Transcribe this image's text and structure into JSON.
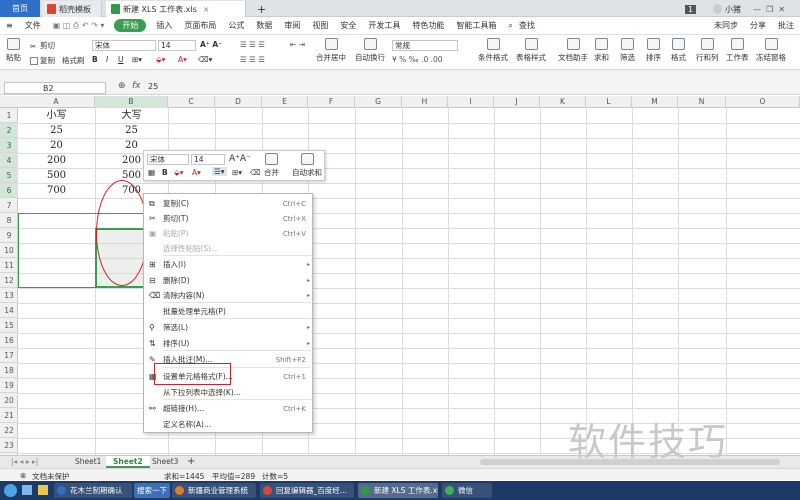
{
  "tabs": {
    "home": "首页",
    "docer": "稻壳模板",
    "doc": "新建 XLS 工作表.xls",
    "add": "+",
    "page_num": "1",
    "user": "小猪"
  },
  "menubar": {
    "file": "文件",
    "items": [
      "开始",
      "插入",
      "页面布局",
      "公式",
      "数据",
      "审阅",
      "视图",
      "安全",
      "开发工具",
      "特色功能",
      "智能工具箱"
    ],
    "search": "查找",
    "unsynced": "未同步",
    "share": "分享",
    "comment": "批注"
  },
  "ribbon": {
    "paste": "粘贴",
    "cut": "剪切",
    "copy": "复制",
    "format_painter": "格式刷",
    "font_name": "宋体",
    "font_size": "14",
    "merge": "合并居中",
    "wrap": "自动换行",
    "number_format": "常规",
    "cond_format": "条件格式",
    "table_style": "表格样式",
    "doc_helper": "文档助手",
    "sum": "求和",
    "filter": "筛选",
    "sort": "排序",
    "format": "格式",
    "rows_cols": "行和列",
    "worksheet": "工作表",
    "freeze": "冻结窗格"
  },
  "formula": {
    "cell_ref": "B2",
    "fx": "fx",
    "value": "25"
  },
  "grid": {
    "columns": [
      "A",
      "B",
      "C",
      "D",
      "E",
      "F",
      "G",
      "H",
      "I",
      "J",
      "K",
      "L",
      "M",
      "N",
      "O"
    ],
    "rows": [
      "1",
      "2",
      "3",
      "4",
      "5",
      "6",
      "7",
      "8",
      "9",
      "10",
      "11",
      "12",
      "13",
      "14",
      "15",
      "16",
      "17",
      "18",
      "19",
      "20",
      "21",
      "22",
      "23"
    ],
    "cells": {
      "A1": "小写",
      "B1": "大写",
      "A2": "25",
      "B2": "25",
      "A3": "20",
      "B3": "20",
      "A4": "200",
      "B4": "200",
      "A5": "500",
      "B5": "500",
      "A6": "700",
      "B6": "700"
    }
  },
  "mini_toolbar": {
    "font": "宋体",
    "size": "14",
    "merge": "合并",
    "autosum": "自动求和"
  },
  "context_menu": [
    {
      "label": "复制(C)",
      "shortcut": "Ctrl+C",
      "disabled": false
    },
    {
      "label": "剪切(T)",
      "shortcut": "Ctrl+X",
      "disabled": false
    },
    {
      "label": "粘贴(P)",
      "shortcut": "Ctrl+V",
      "disabled": true
    },
    {
      "label": "选择性粘贴(S)...",
      "shortcut": "",
      "disabled": true
    },
    {
      "label": "插入(I)",
      "shortcut": "",
      "disabled": false
    },
    {
      "label": "删除(D)",
      "shortcut": "",
      "disabled": false
    },
    {
      "label": "清除内容(N)",
      "shortcut": "",
      "disabled": false
    },
    {
      "label": "批量处理单元格(P)",
      "shortcut": "",
      "disabled": false
    },
    {
      "label": "筛选(L)",
      "shortcut": "",
      "disabled": false
    },
    {
      "label": "排序(U)",
      "shortcut": "",
      "disabled": false
    },
    {
      "label": "插入批注(M)...",
      "shortcut": "Shift+F2",
      "disabled": false
    },
    {
      "label": "设置单元格格式(F)...",
      "shortcut": "Ctrl+1",
      "disabled": false
    },
    {
      "label": "从下拉列表中选择(K)...",
      "shortcut": "",
      "disabled": false
    },
    {
      "label": "超链接(H)...",
      "shortcut": "Ctrl+K",
      "disabled": false
    },
    {
      "label": "定义名称(A)...",
      "shortcut": "",
      "disabled": false
    }
  ],
  "sheets": [
    "Sheet1",
    "Sheet2",
    "Sheet3",
    "+"
  ],
  "status": {
    "protect": "文档未保护",
    "sum": "求和=1445",
    "avg": "平均值=289",
    "count": "计数=5"
  },
  "taskbar": [
    "花木兰制期确认",
    "搜索一下",
    "新疆商业管理系统",
    "回复编辑器_百度经...",
    "新建 XLS 工作表.xls...",
    "微信"
  ],
  "watermark": "软件技巧",
  "colors": {
    "accent": "#3a9d52",
    "annotation": "#d0202a",
    "home_tab": "#2d6fc9"
  }
}
